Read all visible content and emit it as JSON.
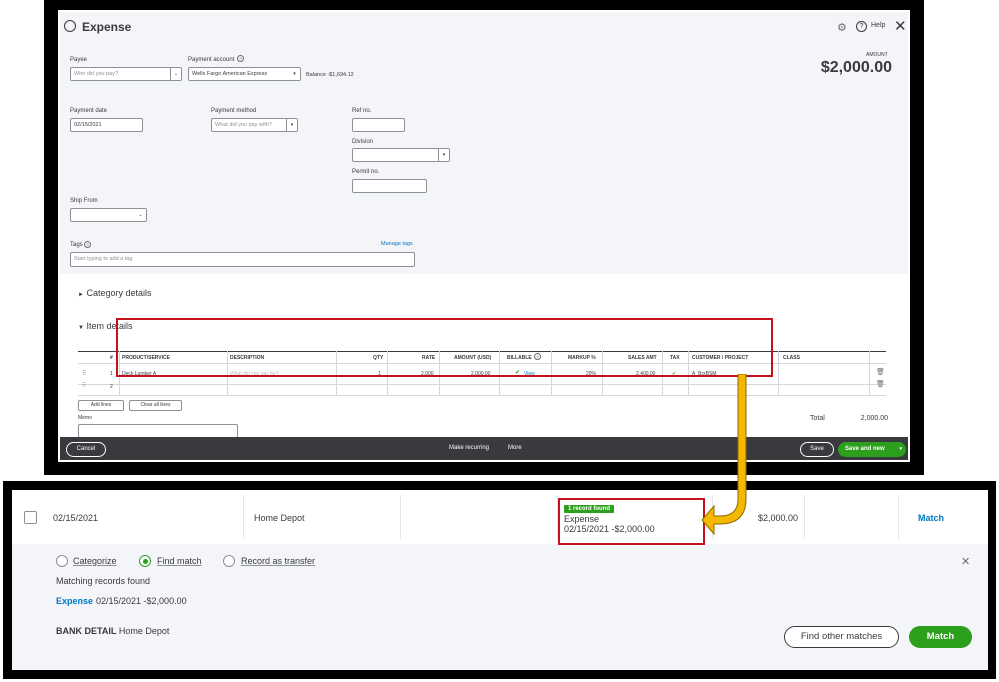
{
  "expense": {
    "title": "Expense",
    "help_label": "Help",
    "amount_label": "AMOUNT",
    "amount_value": "$2,000.00",
    "payee_label": "Payee",
    "payee_placeholder": "Who did you pay?",
    "payment_account_label": "Payment account",
    "payment_account_value": "Wells Fargo American Express",
    "balance_text": "Balance -$1,694.12",
    "payment_date_label": "Payment date",
    "payment_date_value": "02/15/2021",
    "payment_method_label": "Payment method",
    "payment_method_placeholder": "What did you pay with?",
    "ref_no_label": "Ref no.",
    "division_label": "Division",
    "permit_no_label": "Permit no.",
    "ship_from_label": "Ship From",
    "tags_label": "Tags",
    "manage_tags_label": "Manage tags",
    "tags_placeholder": "Start typing to add a tag",
    "category_details_label": "Category details",
    "item_details_label": "Item details",
    "columns": [
      "#",
      "PRODUCT/SERVICE",
      "DESCRIPTION",
      "QTY",
      "RATE",
      "AMOUNT (USD)",
      "BILLABLE",
      "MARKUP %",
      "SALES AMT",
      "TAX",
      "CUSTOMER / PROJECT",
      "CLASS"
    ],
    "rows": [
      {
        "num": "1",
        "product": "Deck Lumber A",
        "description": "What did you pay for?",
        "qty": "1",
        "rate": "2,000",
        "amount": "2,000.00",
        "billable": "View",
        "markup": "20%",
        "sales_amt": "2,400.00",
        "tax": "✔",
        "customer": "A_BrxBSM",
        "class": ""
      },
      {
        "num": "2",
        "product": "",
        "description": "",
        "qty": "",
        "rate": "",
        "amount": "",
        "billable": "",
        "markup": "",
        "sales_amt": "",
        "tax": "",
        "customer": "",
        "class": ""
      }
    ],
    "add_lines_label": "Add lines",
    "clear_all_lines_label": "Clear all lines",
    "memo_label": "Memo",
    "total_label": "Total",
    "total_value": "2,000.00",
    "footer": {
      "cancel_label": "Cancel",
      "make_recurring_label": "Make recurring",
      "more_label": "More",
      "save_label": "Save",
      "save_and_new_label": "Save and new"
    }
  },
  "bank": {
    "date": "02/15/2021",
    "description": "Home Depot",
    "record_badge": "1 record found",
    "record_type": "Expense",
    "record_detail": "02/15/2021 -$2,000.00",
    "amount": "$2,000.00",
    "match_link": "Match",
    "radio_categorize": "Categorize",
    "radio_find_match": "Find match",
    "radio_transfer": "Record as transfer",
    "matching_title": "Matching records found",
    "match_type": "Expense",
    "match_detail": "02/15/2021 -$2,000.00",
    "bank_detail_label": "BANK DETAIL",
    "bank_detail_value": "Home Depot",
    "find_other_label": "Find other matches",
    "match_button_label": "Match"
  },
  "colors": {
    "accent_green": "#2ca01c",
    "link_blue": "#0077c5",
    "highlight_red": "#c4121c",
    "arrow_yellow": "#f5b800",
    "footer_dark": "#393a3d"
  }
}
